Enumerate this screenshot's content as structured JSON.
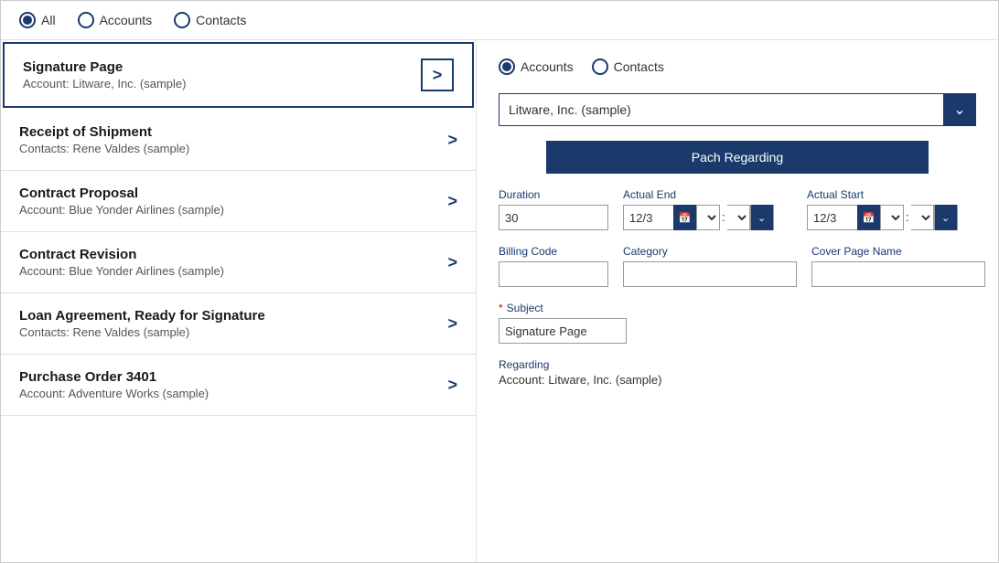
{
  "topFilter": {
    "options": [
      {
        "id": "all",
        "label": "All",
        "selected": true
      },
      {
        "id": "accounts",
        "label": "Accounts",
        "selected": false
      },
      {
        "id": "contacts",
        "label": "Contacts",
        "selected": false
      }
    ]
  },
  "listItems": [
    {
      "title": "Signature Page",
      "subtitle": "Account: Litware, Inc. (sample)",
      "active": true
    },
    {
      "title": "Receipt of Shipment",
      "subtitle": "Contacts: Rene Valdes (sample)",
      "active": false
    },
    {
      "title": "Contract Proposal",
      "subtitle": "Account: Blue Yonder Airlines (sample)",
      "active": false
    },
    {
      "title": "Contract Revision",
      "subtitle": "Account: Blue Yonder Airlines (sample)",
      "active": false
    },
    {
      "title": "Loan Agreement, Ready for Signature",
      "subtitle": "Contacts: Rene Valdes (sample)",
      "active": false
    },
    {
      "title": "Purchase Order 3401",
      "subtitle": "Account: Adventure Works (sample)",
      "active": false
    }
  ],
  "rightPanel": {
    "regardingFilter": {
      "options": [
        {
          "id": "accounts",
          "label": "Accounts",
          "selected": true
        },
        {
          "id": "contacts",
          "label": "Contacts",
          "selected": false
        }
      ]
    },
    "regardingDropdown": {
      "value": "Litware, Inc. (sample)",
      "placeholder": "Litware, Inc. (sample)"
    },
    "patchButton": "Pach Regarding",
    "fields": {
      "duration": {
        "label": "Duration",
        "value": "30"
      },
      "actualEnd": {
        "label": "Actual End",
        "dateValue": "12/3",
        "hourValue": "",
        "minuteValue": ""
      },
      "actualStart": {
        "label": "Actual Start",
        "dateValue": "12/3",
        "hourValue": "",
        "minuteValue": ""
      },
      "billingCode": {
        "label": "Billing Code",
        "value": ""
      },
      "category": {
        "label": "Category",
        "value": ""
      },
      "coverPageName": {
        "label": "Cover Page Name",
        "value": ""
      },
      "subject": {
        "label": "Subject",
        "required": true,
        "value": "Signature Page"
      },
      "regarding": {
        "label": "Regarding",
        "value": "Account: Litware, Inc. (sample)"
      }
    }
  }
}
